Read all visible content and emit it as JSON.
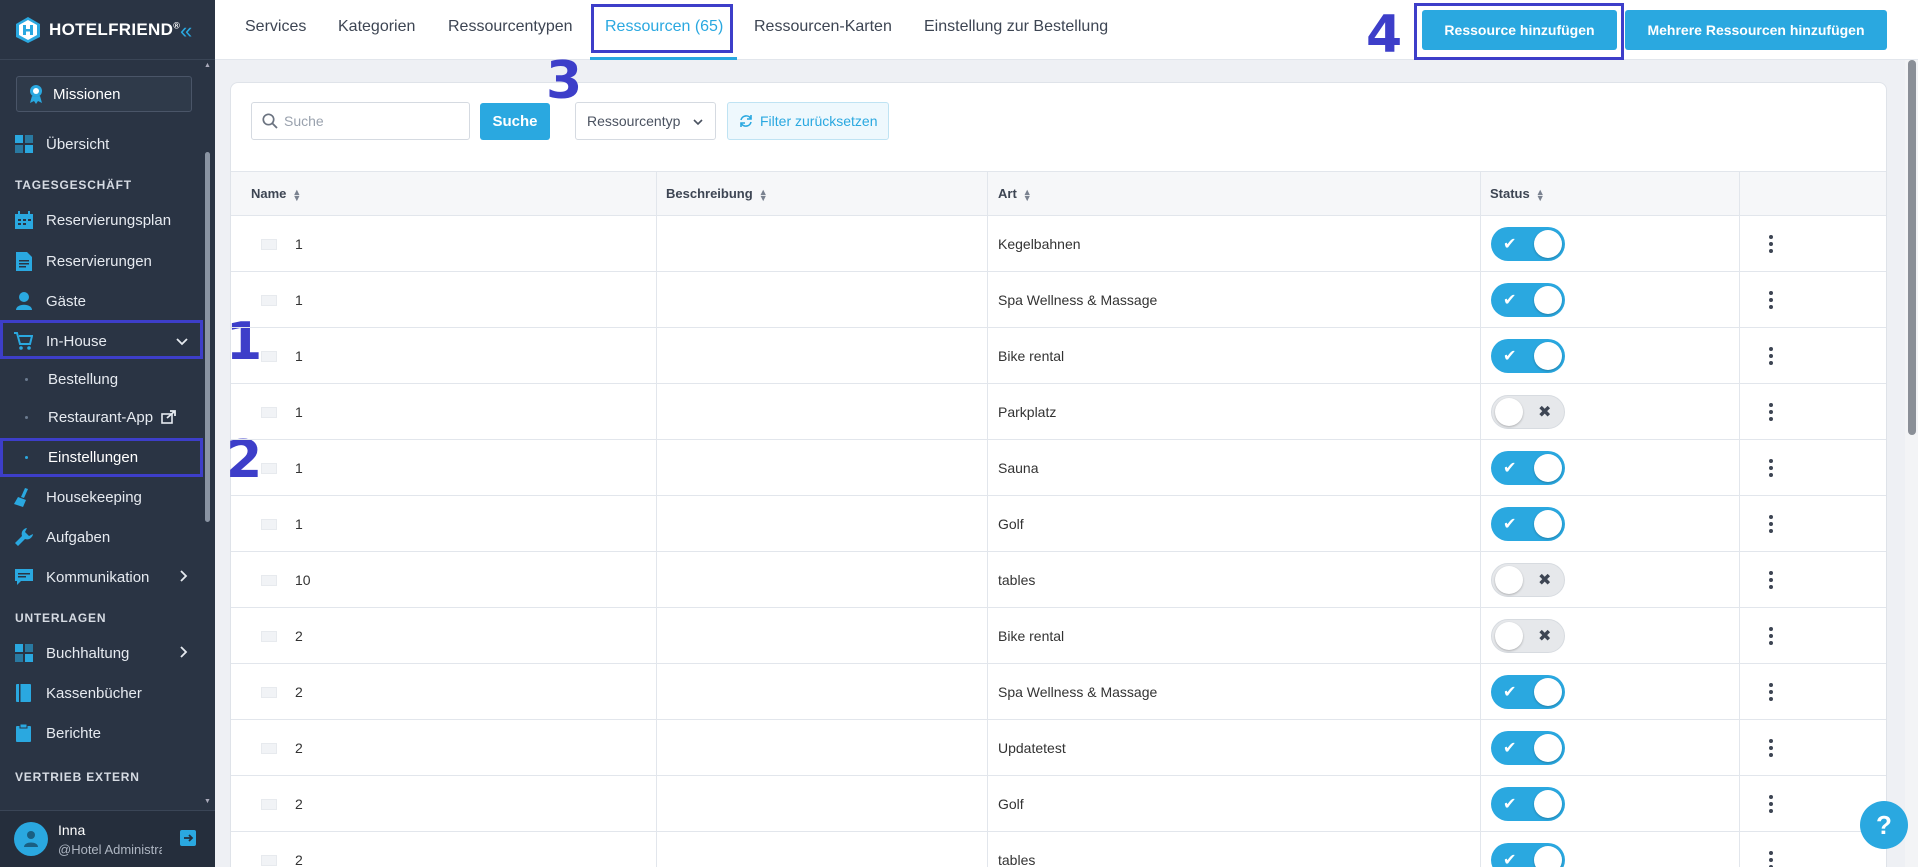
{
  "brand": {
    "name": "HOTELFRIEND",
    "reg": "®"
  },
  "sidebar": {
    "missions": "Missionen",
    "overview": "Übersicht",
    "section_daily": "TAGESGESCHÄFT",
    "reservation_plan": "Reservierungsplan",
    "reservations": "Reservierungen",
    "guests": "Gäste",
    "inhouse": "In-House",
    "sub_order": "Bestellung",
    "sub_restaurant_app": "Restaurant-App",
    "sub_settings": "Einstellungen",
    "housekeeping": "Housekeeping",
    "tasks": "Aufgaben",
    "communication": "Kommunikation",
    "section_docs": "UNTERLAGEN",
    "accounting": "Buchhaltung",
    "cashbooks": "Kassenbücher",
    "reports": "Berichte",
    "section_sales": "VERTRIEB EXTERN",
    "user_name": "Inna",
    "user_role": "@Hotel Administrator"
  },
  "tabs": {
    "services": "Services",
    "categories": "Kategorien",
    "resource_types": "Ressourcentypen",
    "resources": "Ressourcen (65)",
    "resource_maps": "Ressourcen-Karten",
    "order_settings": "Einstellung zur Bestellung"
  },
  "actions": {
    "add_resource": "Ressource hinzufügen",
    "add_multiple": "Mehrere Ressourcen hinzufügen"
  },
  "annotations": {
    "a1": "1",
    "a2": "2",
    "a3": "3",
    "a4": "4"
  },
  "filters": {
    "search_placeholder": "Suche",
    "search_button": "Suche",
    "type_select": "Ressourcentyp",
    "reset": "Filter zurücksetzen"
  },
  "table": {
    "columns": {
      "name": "Name",
      "description": "Beschreibung",
      "type": "Art",
      "status": "Status"
    },
    "rows": [
      {
        "name": "1",
        "description": "",
        "type": "Kegelbahnen",
        "active": true
      },
      {
        "name": "1",
        "description": "",
        "type": "Spa Wellness & Massage",
        "active": true
      },
      {
        "name": "1",
        "description": "",
        "type": "Bike rental",
        "active": true
      },
      {
        "name": "1",
        "description": "",
        "type": "Parkplatz",
        "active": false
      },
      {
        "name": "1",
        "description": "",
        "type": "Sauna",
        "active": true
      },
      {
        "name": "1",
        "description": "",
        "type": "Golf",
        "active": true
      },
      {
        "name": "10",
        "description": "",
        "type": "tables",
        "active": false
      },
      {
        "name": "2",
        "description": "",
        "type": "Bike rental",
        "active": false
      },
      {
        "name": "2",
        "description": "",
        "type": "Spa Wellness & Massage",
        "active": true
      },
      {
        "name": "2",
        "description": "",
        "type": "Updatetest",
        "active": true
      },
      {
        "name": "2",
        "description": "",
        "type": "Golf",
        "active": true
      },
      {
        "name": "2",
        "description": "",
        "type": "tables",
        "active": true
      }
    ]
  },
  "help": "?",
  "colors": {
    "accent": "#2aa8e0",
    "sidebar_bg": "#2a3444",
    "annotation": "#3d3ec9"
  }
}
